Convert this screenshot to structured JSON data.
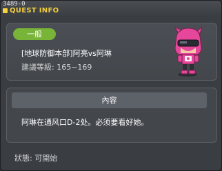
{
  "window": {
    "quest_id": "3489-0",
    "title": "QUEST INFO"
  },
  "quest": {
    "category": "一般",
    "title": "[地球防御本部]阿亮vs阿琳",
    "level_requirement": "建議等級: 165~169"
  },
  "npc": {
    "icon": "pink-helmet-character-icon"
  },
  "content": {
    "header": "內容",
    "text": "阿琳在通风口D-2处。必须要看好她。"
  },
  "status": {
    "text": "狀態: 可開始"
  },
  "colors": {
    "title_text": "#f3cf3a",
    "category_badge": "#78b437",
    "window_bg": "#3a3d42",
    "panel_bg": "#43464b"
  }
}
